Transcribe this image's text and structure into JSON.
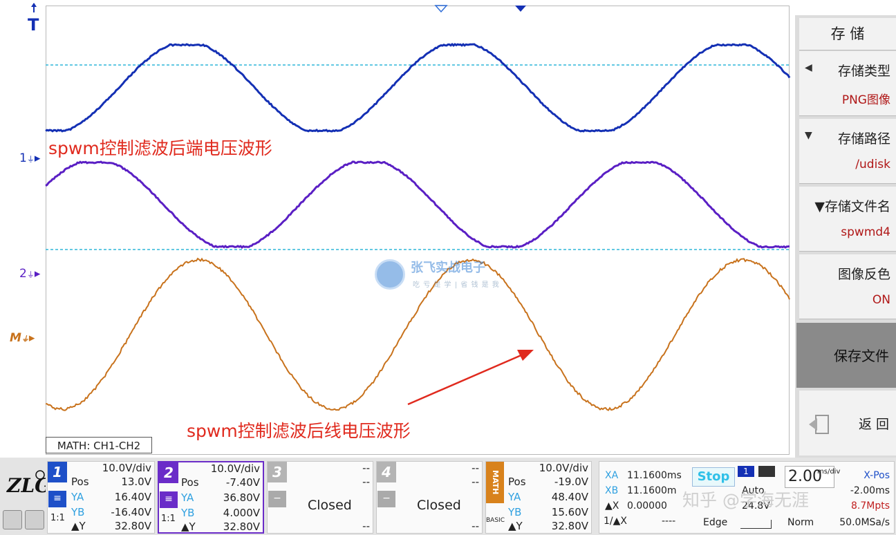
{
  "screen": {
    "trigger_marker": "T",
    "ch1_marker": "1",
    "ch2_marker": "2",
    "math_marker": "M",
    "annotation_top": "spwm控制滤波后端电压波形",
    "annotation_bottom": "spwm控制滤波后线电压波形",
    "math_label": "MATH: CH1-CH2",
    "watermark_title": "张飞实战电子",
    "watermark_sub": "吃 亏 是 学 | 省 钱 是 我"
  },
  "colors": {
    "ch1": "#1430b4",
    "ch2": "#5a1fc4",
    "math": "#c8721c",
    "cursor": "#2fb6d8",
    "annotation": "#e02a1e"
  },
  "menu": {
    "title": "存 储",
    "items": [
      {
        "label": "存储类型",
        "value": "PNG图像",
        "arrow": "◀"
      },
      {
        "label": "存储路径",
        "value": "/udisk",
        "arrow": "▼"
      },
      {
        "label": "▼存储文件名",
        "value": "spwmd4",
        "arrow": ""
      },
      {
        "label": "图像反色",
        "value": "ON",
        "arrow": ""
      }
    ],
    "save": "保存文件",
    "back": "返 回"
  },
  "bottom": {
    "ch1": {
      "num": "1",
      "scale": "10.0V/div",
      "pos_label": "Pos",
      "pos": "13.0V",
      "ya_label": "YA",
      "ya": "16.40V",
      "yb_label": "YB",
      "yb": "-16.40V",
      "dy_label": "▲Y",
      "dy": "32.80V",
      "ratio": "1:1"
    },
    "ch2": {
      "num": "2",
      "scale": "10.0V/div",
      "pos_label": "Pos",
      "pos": "-7.40V",
      "ya_label": "YA",
      "ya": "36.80V",
      "yb_label": "YB",
      "yb": "4.000V",
      "dy_label": "▲Y",
      "dy": "32.80V",
      "ratio": "1:1"
    },
    "ch3": {
      "num": "3",
      "dash1": "--",
      "dash2": "--",
      "status": "Closed",
      "dash3": "--"
    },
    "ch4": {
      "num": "4",
      "dash1": "--",
      "dash2": "--",
      "status": "Closed",
      "dash3": "--"
    },
    "math": {
      "num": "MATH",
      "scale": "10.0V/div",
      "pos_label": "Pos",
      "pos": "-19.0V",
      "ya_label": "YA",
      "ya": "48.40V",
      "yb_label": "YB",
      "yb": "15.60V",
      "dy_label": "▲Y",
      "dy": "32.80V",
      "basic": "BASIC"
    },
    "cursor": {
      "xa_label": "XA",
      "xa": "11.1600ms",
      "xb_label": "XB",
      "xb": "11.1600m",
      "dx_label": "▲X",
      "dx": "0.00000",
      "inv_label": "1/▲X",
      "inv": "----"
    },
    "status": {
      "stop": "Stop",
      "mode": "Auto",
      "trig_level": "24.8V",
      "edge": "Edge",
      "ch": "1",
      "timebase": "2.00",
      "timebase_unit": "ms/div",
      "xpos_label": "X-Pos",
      "xpos": "-2.00ms",
      "depth": "8.7Mpts",
      "norm": "Norm",
      "rate": "50.0MSa/s"
    },
    "watermark": "知乎 @学海无涯"
  }
}
